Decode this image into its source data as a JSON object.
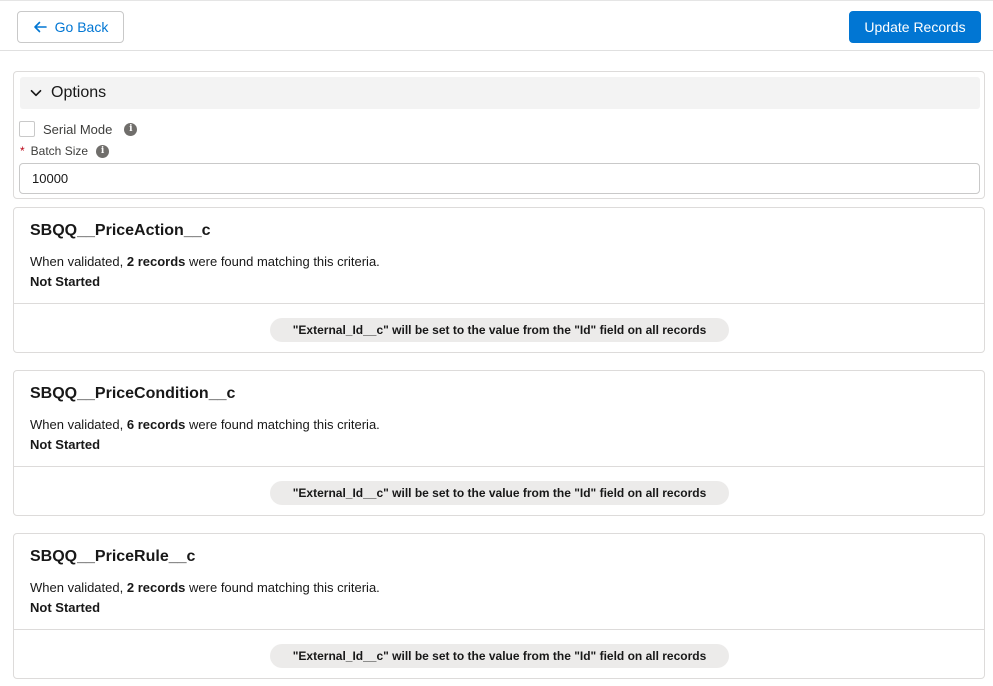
{
  "toolbar": {
    "back_label": "Go Back",
    "update_label": "Update Records"
  },
  "options": {
    "title": "Options",
    "serial_mode_label": "Serial Mode",
    "batch_size_label": "Batch Size",
    "required_marker": "*",
    "batch_size_value": "10000",
    "info_glyph": "i"
  },
  "objects": [
    {
      "name": "SBQQ__PriceAction__c",
      "desc_prefix": "When validated,",
      "count_text": "2 records",
      "desc_suffix": "were found matching this criteria.",
      "status": "Not Started",
      "mapping": "\"External_Id__c\" will be set to the value from the \"Id\" field on all records"
    },
    {
      "name": "SBQQ__PriceCondition__c",
      "desc_prefix": "When validated,",
      "count_text": "6 records",
      "desc_suffix": "were found matching this criteria.",
      "status": "Not Started",
      "mapping": "\"External_Id__c\" will be set to the value from the \"Id\" field on all records"
    },
    {
      "name": "SBQQ__PriceRule__c",
      "desc_prefix": "When validated,",
      "count_text": "2 records",
      "desc_suffix": "were found matching this criteria.",
      "status": "Not Started",
      "mapping": "\"External_Id__c\" will be set to the value from the \"Id\" field on all records"
    }
  ],
  "colors": {
    "brand": "#0176d3",
    "required": "#ba0517",
    "pill_bg": "#ecebea"
  },
  "icons": [
    "arrow-left-icon",
    "chevron-down-icon",
    "info-icon"
  ]
}
